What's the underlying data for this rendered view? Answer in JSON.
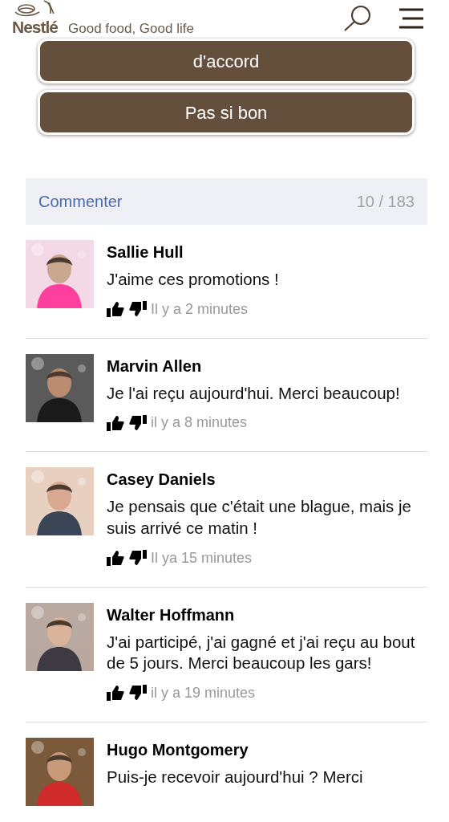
{
  "header": {
    "logo_text": "Nestlé",
    "tagline": "Good food, Good life"
  },
  "answers": [
    {
      "label": "d'accord"
    },
    {
      "label": "Pas si bon"
    }
  ],
  "comments_bar": {
    "title": "Commenter",
    "count": "10 / 183"
  },
  "comments": [
    {
      "name": "Sallie Hull",
      "text": "J'aime ces promotions !",
      "time": "Il y a 2 minutes"
    },
    {
      "name": "Marvin Allen",
      "text": "Je l'ai reçu aujourd'hui. Merci beaucoup!",
      "time": "il y a 8 minutes"
    },
    {
      "name": "Casey Daniels",
      "text": "Je pensais que c'était une blague, mais je suis arrivé ce matin !",
      "time": "Il ya 15 minutes"
    },
    {
      "name": "Walter Hoffmann",
      "text": "J'ai participé, j'ai gagné et j'ai reçu au bout de 5 jours. Merci beaucoup les gars!",
      "time": "il y a 19 minutes"
    },
    {
      "name": "Hugo Montgomery",
      "text": "Puis-je recevoir aujourd'hui ? Merci"
    }
  ]
}
